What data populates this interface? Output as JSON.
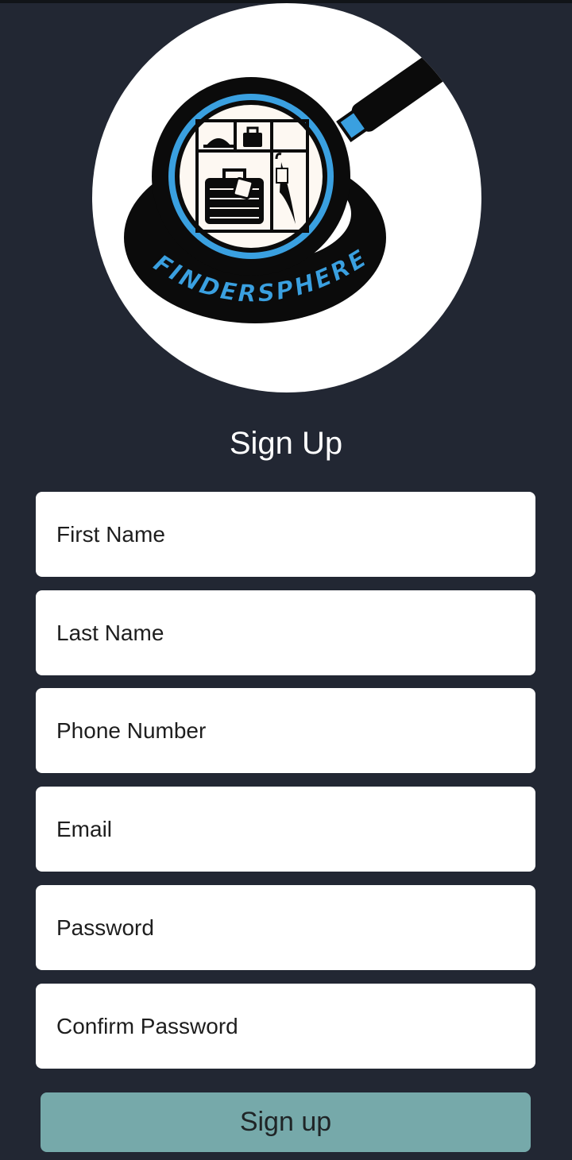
{
  "logo": {
    "brand_text": "FINDERSPHERE",
    "accent_color": "#3aa0e0",
    "icon_name": "magnifier-lost-and-found-logo"
  },
  "form": {
    "title": "Sign Up",
    "fields": [
      {
        "placeholder": "First Name",
        "value": ""
      },
      {
        "placeholder": "Last Name",
        "value": ""
      },
      {
        "placeholder": "Phone Number",
        "value": ""
      },
      {
        "placeholder": "Email",
        "value": ""
      },
      {
        "placeholder": "Password",
        "value": ""
      },
      {
        "placeholder": "Confirm Password",
        "value": ""
      }
    ],
    "submit_label": "Sign up"
  },
  "colors": {
    "background": "#222733",
    "button": "#76a9aa",
    "field_background": "#ffffff"
  }
}
